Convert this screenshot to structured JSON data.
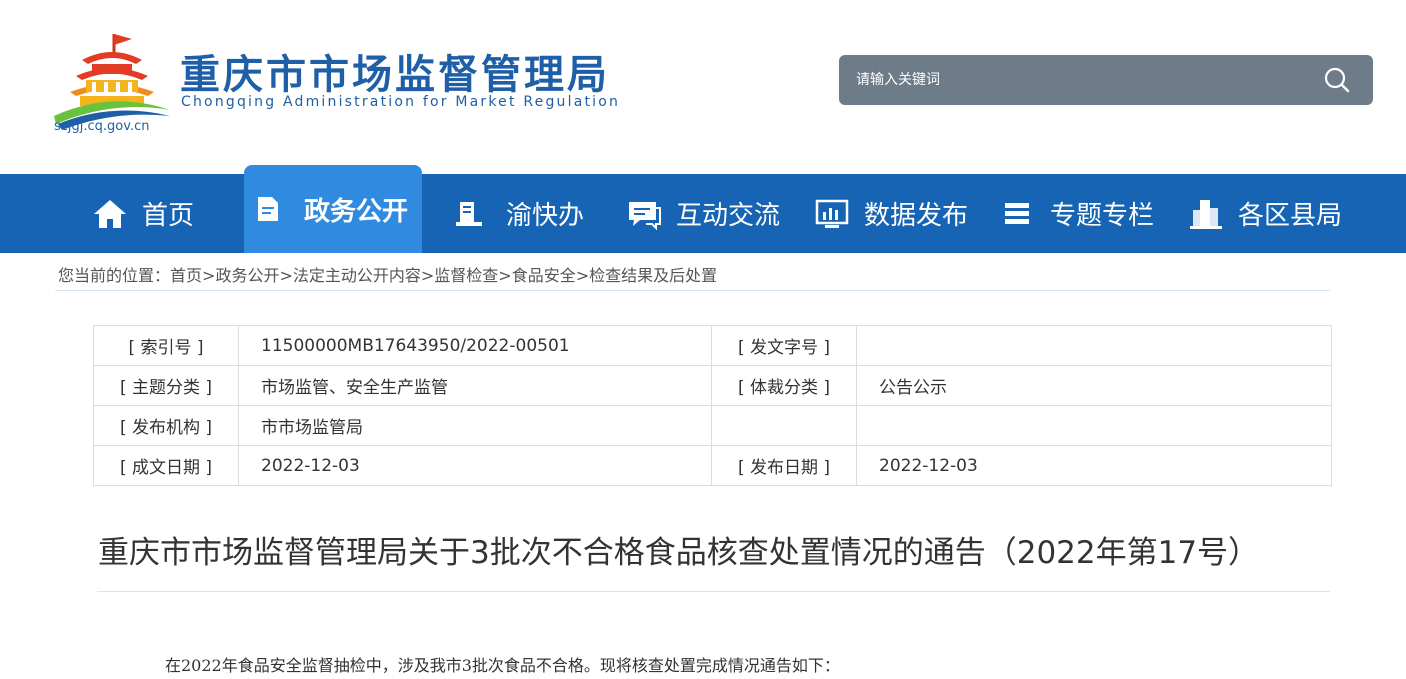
{
  "header": {
    "site_title": "重庆市市场监督管理局",
    "site_subtitle": "Chongqing  Administration for Market Regulation",
    "domain": "scjgj.cq.gov.cn"
  },
  "search": {
    "placeholder": "请输入关键词"
  },
  "nav": {
    "items": [
      {
        "label": "首页",
        "icon": "home-icon"
      },
      {
        "label": "政务公开",
        "icon": "document-icon"
      },
      {
        "label": "渝快办",
        "icon": "service-icon"
      },
      {
        "label": "互动交流",
        "icon": "chat-icon"
      },
      {
        "label": "数据发布",
        "icon": "chart-icon"
      },
      {
        "label": "专题专栏",
        "icon": "list-icon"
      },
      {
        "label": "各区县局",
        "icon": "building-icon"
      }
    ],
    "active_index": 1
  },
  "breadcrumb": {
    "prefix": "您当前的位置：",
    "items": [
      "首页",
      "政务公开",
      "法定主动公开内容",
      "监督检查",
      "食品安全",
      "检查结果及后处置"
    ]
  },
  "meta": {
    "rows": [
      {
        "k1": "[ 索引号 ]",
        "v1": "11500000MB17643950/2022-00501",
        "k2": "[ 发文字号 ]",
        "v2": ""
      },
      {
        "k1": "[ 主题分类 ]",
        "v1": "市场监管、安全生产监管",
        "k2": "[ 体裁分类 ]",
        "v2": "公告公示"
      },
      {
        "k1": "[ 发布机构 ]",
        "v1": "市市场监管局",
        "k2": "",
        "v2": ""
      },
      {
        "k1": "[ 成文日期 ]",
        "v1": "2022-12-03",
        "k2": "[ 发布日期 ]",
        "v2": "2022-12-03"
      }
    ]
  },
  "article": {
    "title": "重庆市市场监督管理局关于3批次不合格食品核查处置情况的通告（2022年第17号）",
    "intro": "在2022年食品安全监督抽检中，涉及我市3批次食品不合格。现将核查处置完成情况通告如下："
  },
  "colors": {
    "nav_bg": "#1664b3",
    "nav_active": "#2f8ae0",
    "brand": "#1f5fa8",
    "search_bg": "#6e7c8a"
  }
}
